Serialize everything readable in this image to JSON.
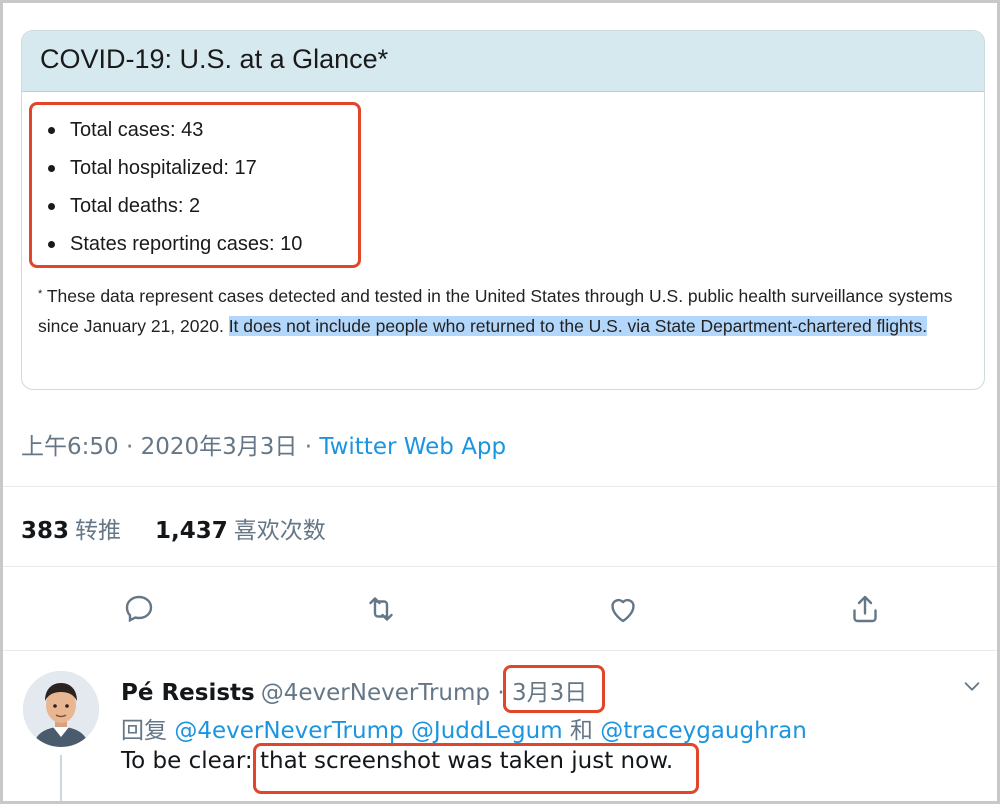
{
  "card": {
    "title": "COVID-19: U.S. at a Glance*",
    "stats": [
      "Total cases: 43",
      "Total hospitalized: 17",
      "Total deaths: 2",
      "States reporting cases: 10"
    ],
    "note_marker": "*",
    "note_plain": " These data represent cases detected and tested in the United States through U.S. public health surveillance systems since January 21, 2020. ",
    "note_selected": "It does not include people who returned to the U.S. via State Department-chartered flights",
    "note_end": "."
  },
  "tweet": {
    "time": "上午6:50",
    "date": "2020年3月3日",
    "separator": "·",
    "source": "Twitter Web App",
    "retweets_count": "383",
    "retweets_label": "转推",
    "likes_count": "1,437",
    "likes_label": "喜欢次数"
  },
  "actions": [
    "reply-icon",
    "retweet-icon",
    "like-icon",
    "share-icon"
  ],
  "reply": {
    "name": "Pé Resists",
    "handle": "@4everNeverTrump",
    "separator": "·",
    "date": "3月3日",
    "replying_label": "回复",
    "mention_1": "@4everNeverTrump",
    "mention_2": "@JuddLegum",
    "and": "和",
    "mention_3": "@traceygaughran",
    "text_start": "To be clear: ",
    "text_highlight": "that screenshot was taken just now."
  },
  "colors": {
    "link": "#1b95e0",
    "muted": "#657786",
    "highlight_box": "#e2462a",
    "card_header": "#d5e9ee",
    "selection": "#b3d6fb"
  }
}
